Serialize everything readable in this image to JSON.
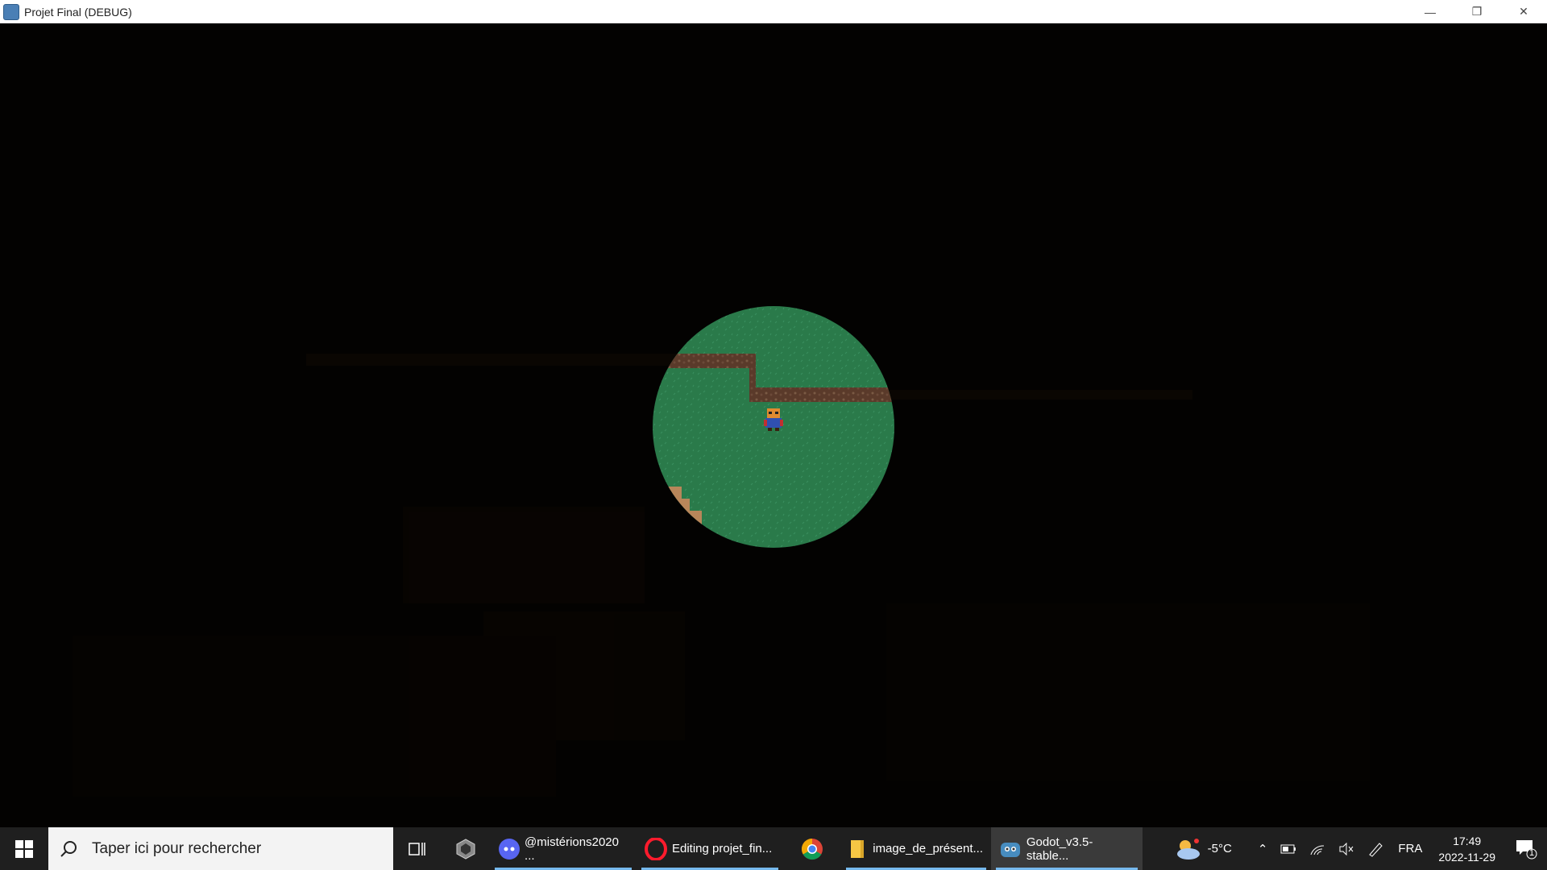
{
  "window": {
    "title": "Projet Final (DEBUG)",
    "minimize_label": "—",
    "restore_label": "❐",
    "close_label": "✕"
  },
  "game": {
    "colors": {
      "background": "#030201",
      "grass": "#2a7a4a",
      "dirt": "#6b4a38",
      "sand": "#b8865a"
    }
  },
  "taskbar": {
    "search_placeholder": "Taper ici pour rechercher",
    "apps": [
      {
        "icon": "discord-icon",
        "label": "@mistérions2020 ..."
      },
      {
        "icon": "opera-icon",
        "label": "Editing projet_fin..."
      },
      {
        "icon": "chrome-icon",
        "label": ""
      },
      {
        "icon": "folder-icon",
        "label": "image_de_présent..."
      },
      {
        "icon": "godot-icon",
        "label": "Godot_v3.5-stable..."
      }
    ],
    "weather": {
      "temp": "-5°C"
    },
    "language": "FRA",
    "time": "17:49",
    "date": "2022-11-29",
    "notification_count": "1"
  }
}
